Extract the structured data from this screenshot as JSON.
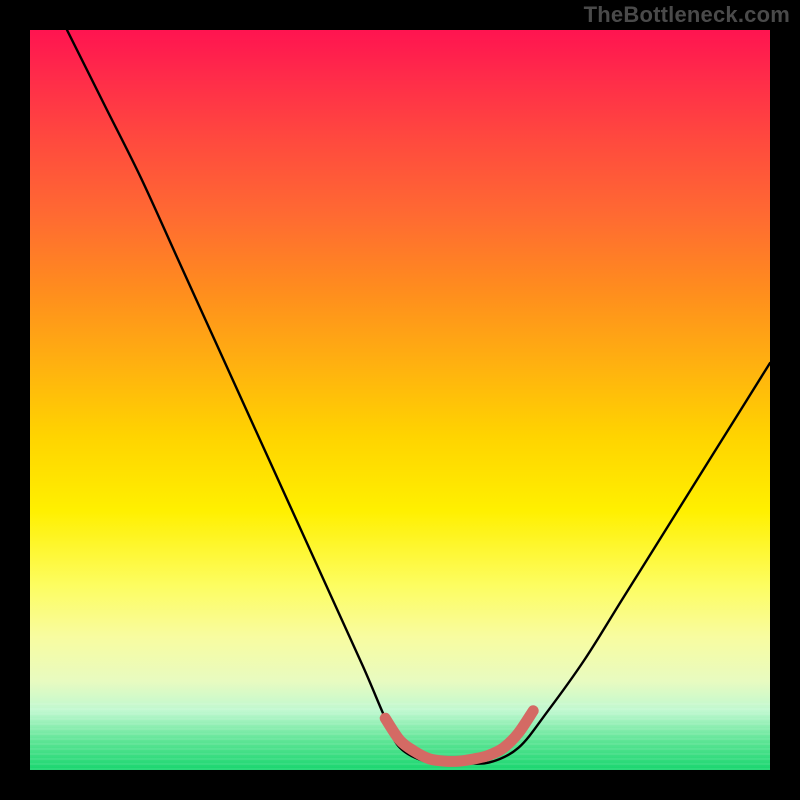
{
  "watermark": "TheBottleneck.com",
  "chart_data": {
    "type": "line",
    "title": "",
    "xlabel": "",
    "ylabel": "",
    "xlim": [
      0,
      100
    ],
    "ylim": [
      0,
      100
    ],
    "grid": false,
    "legend": false,
    "background_gradient": {
      "direction": "vertical",
      "stops": [
        {
          "pos": 0.0,
          "color": "#ff1450"
        },
        {
          "pos": 0.15,
          "color": "#ff4a3e"
        },
        {
          "pos": 0.35,
          "color": "#ff8c1e"
        },
        {
          "pos": 0.55,
          "color": "#ffd400"
        },
        {
          "pos": 0.75,
          "color": "#fdfd60"
        },
        {
          "pos": 0.92,
          "color": "#c0f8d0"
        },
        {
          "pos": 1.0,
          "color": "#19d66f"
        }
      ]
    },
    "series": [
      {
        "name": "bottleneck-curve",
        "color": "#000000",
        "x": [
          5,
          10,
          15,
          20,
          25,
          30,
          35,
          40,
          45,
          48,
          50,
          54,
          58,
          62,
          66,
          70,
          75,
          80,
          85,
          90,
          95,
          100
        ],
        "values": [
          100,
          90,
          80,
          69,
          58,
          47,
          36,
          25,
          14,
          7,
          3,
          1,
          1,
          1,
          3,
          8,
          15,
          23,
          31,
          39,
          47,
          55
        ]
      },
      {
        "name": "optimal-zone-marker",
        "color": "#d46a64",
        "x": [
          48,
          50,
          52,
          54,
          56,
          58,
          60,
          62,
          64,
          66,
          68
        ],
        "values": [
          7,
          4,
          2.5,
          1.5,
          1.2,
          1.2,
          1.5,
          2,
          3,
          5,
          8
        ]
      }
    ],
    "annotations": []
  }
}
